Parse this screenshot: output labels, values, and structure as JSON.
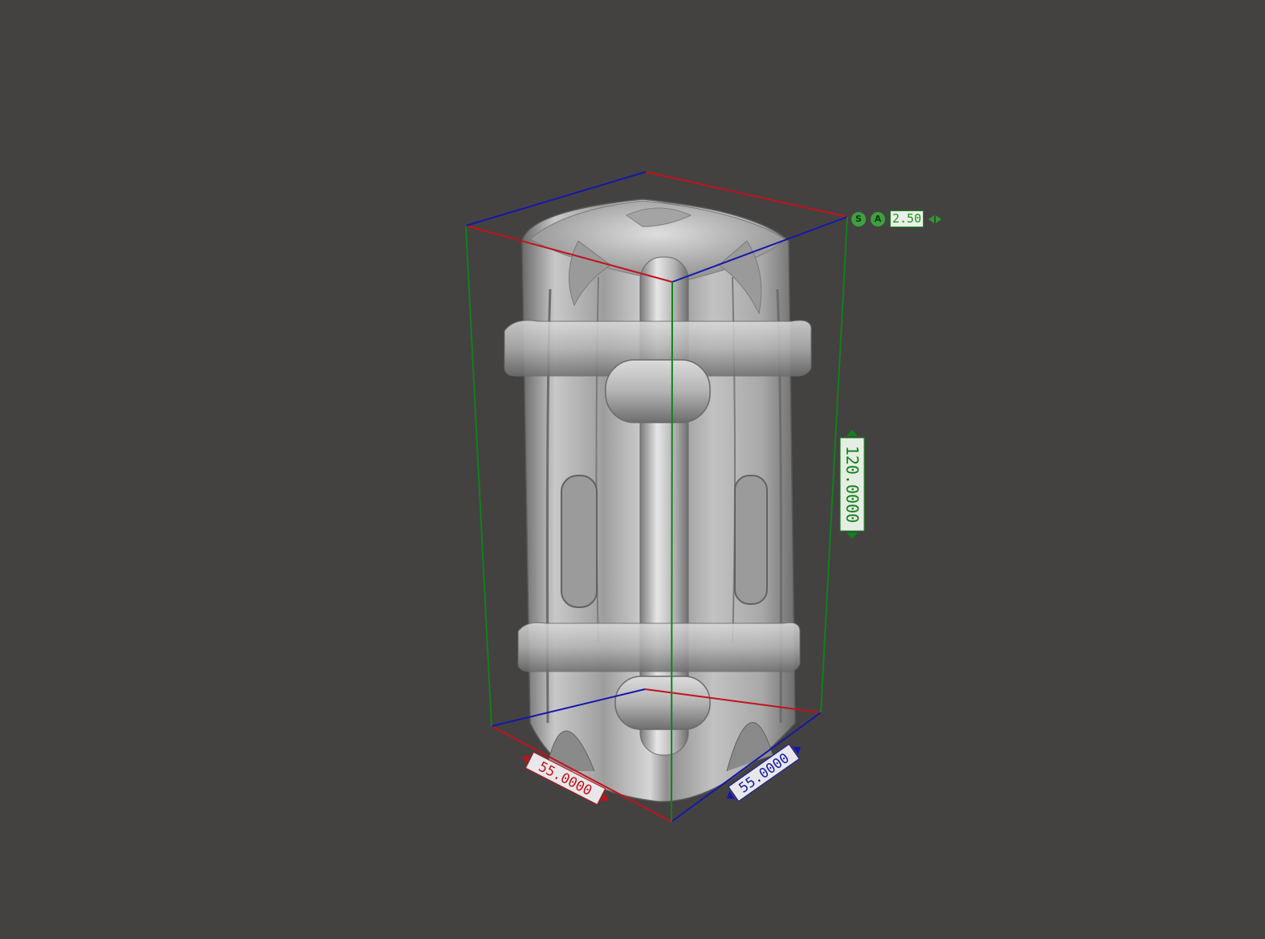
{
  "scene": {
    "object": "column-model",
    "background_color": "#434241"
  },
  "bounding_box": {
    "colors": {
      "x_axis": "#c3121b",
      "y_axis": "#12801c",
      "z_axis": "#1518a9"
    }
  },
  "dimensions": {
    "width_label": "55.0000",
    "depth_label": "55.0000",
    "height_label": "120.0000"
  },
  "snap_hud": {
    "snap_icon_label": "S",
    "angle_icon_label": "A",
    "value": "2.50",
    "decrement_icon": "arrow-left-icon",
    "increment_icon": "arrow-right-icon"
  }
}
